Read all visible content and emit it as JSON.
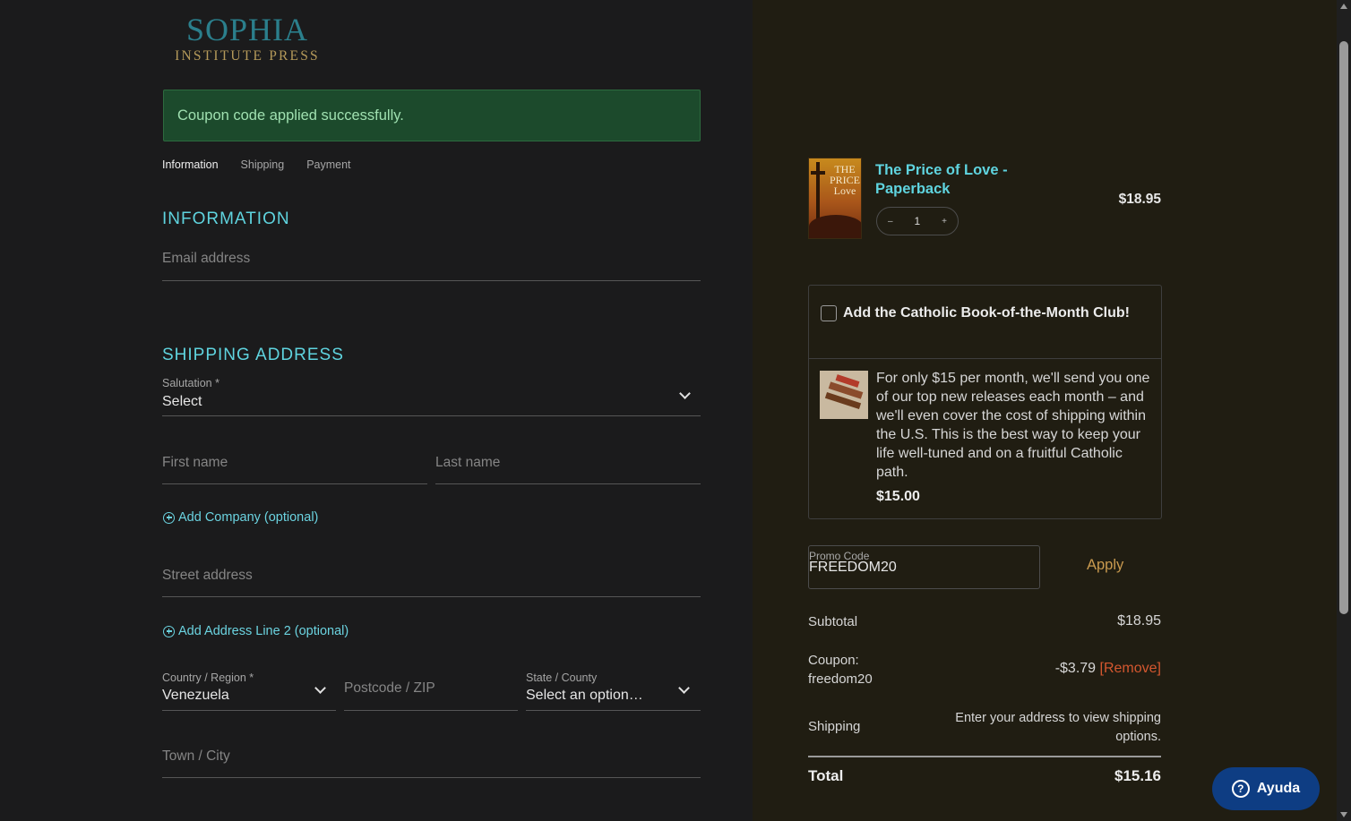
{
  "logo": {
    "main": "SOPHIA",
    "sub": "INSTITUTE PRESS"
  },
  "alert": {
    "message": "Coupon code applied successfully."
  },
  "steps": [
    "Information",
    "Shipping",
    "Payment"
  ],
  "information": {
    "title": "INFORMATION",
    "email_placeholder": "Email address"
  },
  "shipping": {
    "title": "SHIPPING ADDRESS",
    "salutation_label": "Salutation *",
    "salutation_value": "Select",
    "first_name_placeholder": "First name",
    "last_name_placeholder": "Last name",
    "add_company": "Add Company (optional)",
    "street_placeholder": "Street address",
    "add_line2": "Add Address Line 2 (optional)",
    "country_label": "Country / Region *",
    "country_value": "Venezuela",
    "postcode_placeholder": "Postcode / ZIP",
    "state_label": "State / County",
    "state_value": "Select an option…",
    "town_placeholder": "Town / City"
  },
  "cart": {
    "product_title": "The Price of Love - Paperback",
    "cover_text": "THE PRICE Love",
    "qty_minus": "–",
    "qty_value": "1",
    "qty_plus": "+",
    "price": "$18.95"
  },
  "club": {
    "title": "Add the Catholic Book-of-the-Month Club!",
    "description": "For only $15 per month, we'll send you one of our top new releases each month – and we'll even cover the cost of shipping within the U.S. This is the best way to keep your life well-tuned and on a fruitful Catholic path.",
    "price": "$15.00"
  },
  "promo": {
    "label": "Promo Code",
    "value": "FREEDOM20",
    "apply": "Apply"
  },
  "summary": {
    "subtotal_label": "Subtotal",
    "subtotal_value": "$18.95",
    "coupon_label_1": "Coupon:",
    "coupon_label_2": "freedom20",
    "coupon_value": "-$3.79",
    "coupon_remove": "[Remove]",
    "shipping_label": "Shipping",
    "shipping_value_1": "Enter your address to view shipping",
    "shipping_value_2": "options.",
    "total_label": "Total",
    "total_value": "$15.16"
  },
  "help": {
    "label": "Ayuda",
    "icon": "?"
  },
  "colors": {
    "accent": "#5fd4df",
    "success_bg": "#1c4a2c",
    "apply": "#c99a4f",
    "remove": "#d4572f",
    "help_bg": "#0e3d83"
  }
}
